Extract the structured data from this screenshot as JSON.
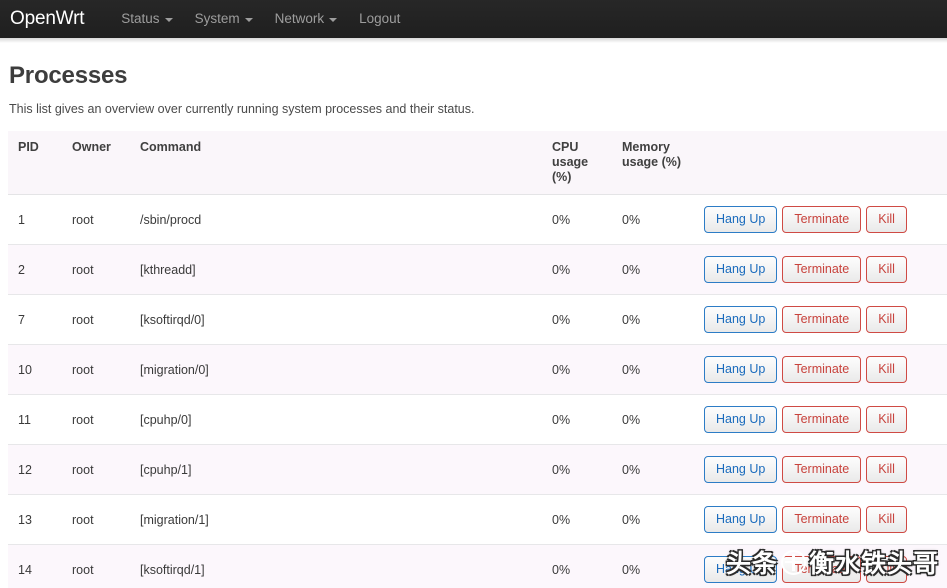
{
  "nav": {
    "brand": "OpenWrt",
    "items": [
      {
        "label": "Status",
        "has_caret": true
      },
      {
        "label": "System",
        "has_caret": true
      },
      {
        "label": "Network",
        "has_caret": true
      },
      {
        "label": "Logout",
        "has_caret": false
      }
    ]
  },
  "page": {
    "title": "Processes",
    "description": "This list gives an overview over currently running system processes and their status."
  },
  "table": {
    "headers": {
      "pid": "PID",
      "owner": "Owner",
      "command": "Command",
      "cpu": "CPU usage (%)",
      "memory": "Memory usage (%)",
      "actions": ""
    },
    "action_labels": {
      "hangup": "Hang Up",
      "terminate": "Terminate",
      "kill": "Kill"
    },
    "rows": [
      {
        "pid": "1",
        "owner": "root",
        "command": "/sbin/procd",
        "cpu": "0%",
        "memory": "0%"
      },
      {
        "pid": "2",
        "owner": "root",
        "command": "[kthreadd]",
        "cpu": "0%",
        "memory": "0%"
      },
      {
        "pid": "7",
        "owner": "root",
        "command": "[ksoftirqd/0]",
        "cpu": "0%",
        "memory": "0%"
      },
      {
        "pid": "10",
        "owner": "root",
        "command": "[migration/0]",
        "cpu": "0%",
        "memory": "0%"
      },
      {
        "pid": "11",
        "owner": "root",
        "command": "[cpuhp/0]",
        "cpu": "0%",
        "memory": "0%"
      },
      {
        "pid": "12",
        "owner": "root",
        "command": "[cpuhp/1]",
        "cpu": "0%",
        "memory": "0%"
      },
      {
        "pid": "13",
        "owner": "root",
        "command": "[migration/1]",
        "cpu": "0%",
        "memory": "0%"
      },
      {
        "pid": "14",
        "owner": "root",
        "command": "[ksoftirqd/1]",
        "cpu": "0%",
        "memory": "0%"
      }
    ]
  },
  "watermark": {
    "prefix": "头条",
    "icon": "at-sign-icon",
    "suffix": "衡水铁头哥"
  },
  "colors": {
    "nav_background": "#222222",
    "brand_text": "#ffffff",
    "nav_text": "#9d9d9d",
    "button_blue": "#1a6bbd",
    "button_red": "#c8433d",
    "row_alt_background": "#fcf7fc",
    "header_background": "#faf6fa"
  }
}
